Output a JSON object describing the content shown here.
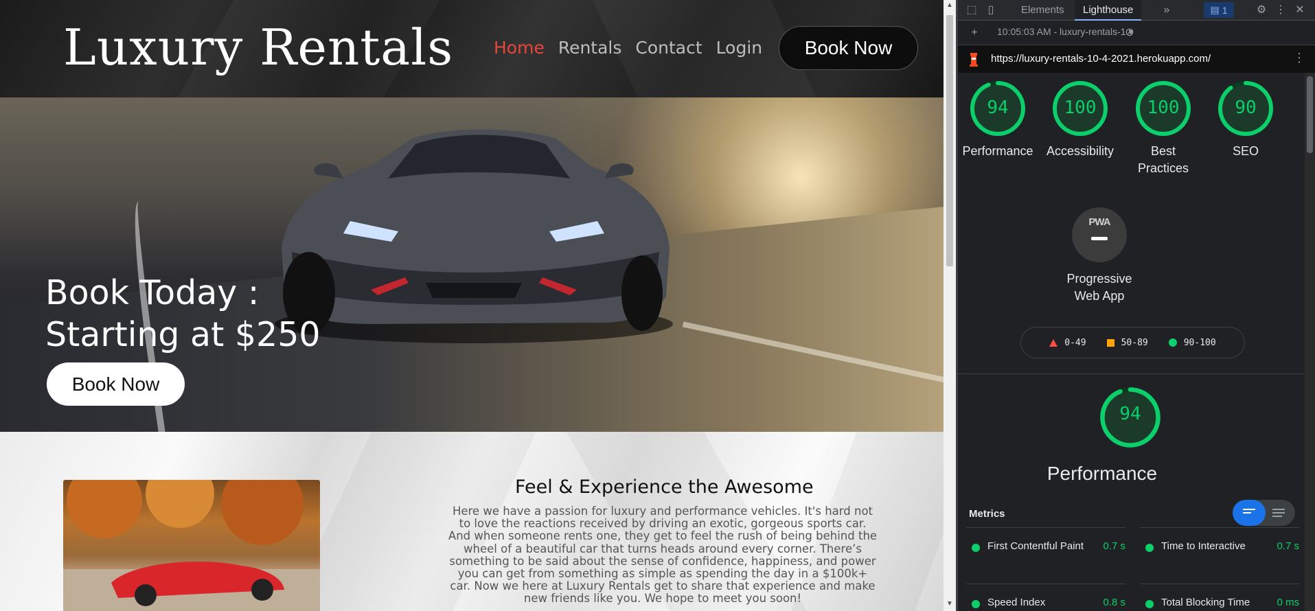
{
  "site": {
    "logo": "Luxury Rentals",
    "nav": [
      "Home",
      "Rentals",
      "Contact",
      "Login"
    ],
    "nav_active": "Home",
    "header_cta": "Book Now",
    "hero_title": "Book Today :\nStarting at $250",
    "hero_cta": "Book Now",
    "about_title": "Feel & Experience the Awesome",
    "about_text": "Here we have a passion for luxury and performance vehicles. It's hard not to love the reactions received by driving an exotic, gorgeous sports car. And when someone rents one, they get to feel the rush of being behind the wheel of a beautiful car that turns heads around every corner. There’s something to be said about the sense of confidence, happiness, and power you can get from something as simple as spending the day in a $100k+ car. Now we here at Luxury Rentals get to share that experience and make new friends like you. We hope to meet you soon!"
  },
  "devtools": {
    "tabs": [
      "Elements",
      "Lighthouse"
    ],
    "active_tab": "Lighthouse",
    "more_tabs_icon": "chevron-double-right-icon",
    "issues_badge": "1",
    "session": "10:05:03 AM - luxury-rentals-1",
    "url": "https://luxury-rentals-10-4-2021.herokuapp.com/",
    "scores": [
      {
        "value": 94,
        "label": "Performance"
      },
      {
        "value": 100,
        "label": "Accessibility"
      },
      {
        "value": 100,
        "label": "Best Practices"
      },
      {
        "value": 90,
        "label": "SEO"
      }
    ],
    "pwa": {
      "badge_text": "PWA",
      "label": "Progressive Web App"
    },
    "legend": [
      "0-49",
      "50-89",
      "90-100"
    ],
    "performance": {
      "value": 94,
      "title": "Performance"
    },
    "metrics_label": "Metrics",
    "metrics": [
      {
        "name": "First Contentful Paint",
        "value": "0.7 s"
      },
      {
        "name": "Time to Interactive",
        "value": "0.7 s"
      },
      {
        "name": "Speed Index",
        "value": "0.8 s"
      },
      {
        "name": "Total Blocking Time",
        "value": "0 ms"
      }
    ],
    "colors": {
      "pass": "#0cce6b",
      "average": "#ffa400",
      "fail": "#ff4e42",
      "accent": "#1a73e8",
      "nav_active": "#e8453c"
    }
  }
}
